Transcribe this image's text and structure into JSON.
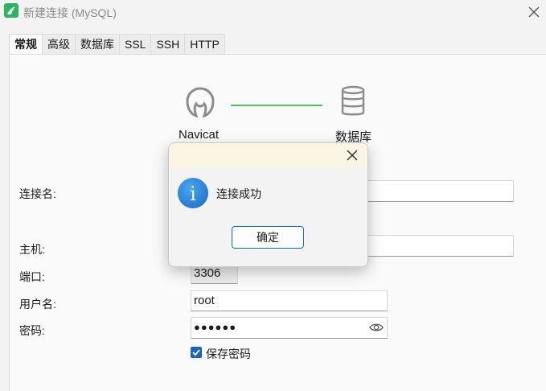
{
  "window": {
    "title": "新建连接 (MySQL)"
  },
  "tabs": [
    "常规",
    "高级",
    "数据库",
    "SSL",
    "SSH",
    "HTTP"
  ],
  "diagram": {
    "left_label": "Navicat",
    "right_label": "数据库"
  },
  "form": {
    "connection_name_label": "连接名:",
    "host_label": "主机:",
    "port_label": "端口:",
    "port_value": "3306",
    "user_label": "用户名:",
    "user_value": "root",
    "password_label": "密码:",
    "password_value": "●●●●●●",
    "save_password_label": "保存密码",
    "save_password_checked": true
  },
  "dialog": {
    "message": "连接成功",
    "ok_label": "确定"
  },
  "colors": {
    "accent": "#1a64c4",
    "line": "#44c35c",
    "app_icon": "#29b45e"
  }
}
